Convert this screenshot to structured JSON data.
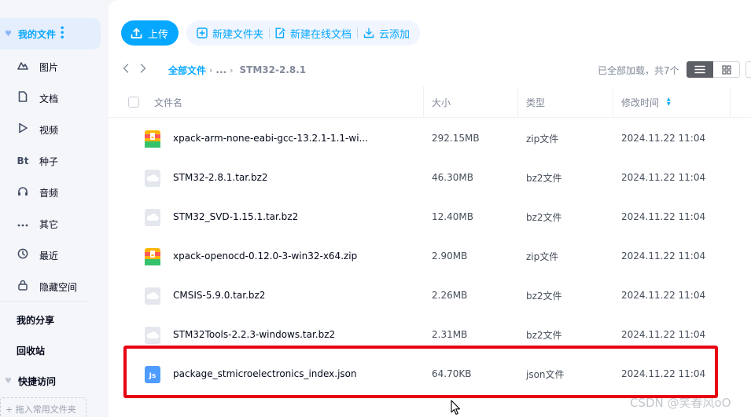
{
  "sidebar": {
    "my_files": "我的文件",
    "categories": [
      {
        "icon": "image-icon",
        "label": "图片"
      },
      {
        "icon": "document-icon",
        "label": "文档"
      },
      {
        "icon": "video-icon",
        "label": "视频"
      },
      {
        "icon": "torrent-icon",
        "glyph": "Bt",
        "label": "种子"
      },
      {
        "icon": "headphones-icon",
        "label": "音频"
      },
      {
        "icon": "more-icon",
        "label": "其它"
      },
      {
        "icon": "clock-icon",
        "label": "最近"
      },
      {
        "icon": "lock-icon",
        "label": "隐藏空间"
      }
    ],
    "my_share": "我的分享",
    "recycle_bin": "回收站",
    "quick_access": "快捷访问",
    "drop_hint": "+ 拖入常用文件夹"
  },
  "toolbar": {
    "upload": "上传",
    "new_folder": "新建文件夹",
    "new_online_doc": "新建在线文档",
    "cloud_add": "云添加"
  },
  "breadcrumb": {
    "root": "全部文件",
    "ellipsis": "...",
    "current": "STM32-2.8.1"
  },
  "status": {
    "loaded": "已全部加载，共7个"
  },
  "table": {
    "headers": {
      "name": "文件名",
      "size": "大小",
      "type": "类型",
      "modified": "修改时间"
    },
    "rows": [
      {
        "icon": "zip-icon",
        "name": "xpack-arm-none-eabi-gcc-13.2.1-1.1-wi...",
        "size": "292.15MB",
        "type": "zip文件",
        "modified": "2024.11.22 11:04"
      },
      {
        "icon": "file-icon",
        "name": "STM32-2.8.1.tar.bz2",
        "size": "46.30MB",
        "type": "bz2文件",
        "modified": "2024.11.22 11:04"
      },
      {
        "icon": "file-icon",
        "name": "STM32_SVD-1.15.1.tar.bz2",
        "size": "12.40MB",
        "type": "bz2文件",
        "modified": "2024.11.22 11:04"
      },
      {
        "icon": "zip-icon",
        "name": "xpack-openocd-0.12.0-3-win32-x64.zip",
        "size": "2.90MB",
        "type": "zip文件",
        "modified": "2024.11.22 11:04"
      },
      {
        "icon": "file-icon",
        "name": "CMSIS-5.9.0.tar.bz2",
        "size": "2.26MB",
        "type": "bz2文件",
        "modified": "2024.11.22 11:04"
      },
      {
        "icon": "file-icon",
        "name": "STM32Tools-2.2.3-windows.tar.bz2",
        "size": "2.31MB",
        "type": "bz2文件",
        "modified": "2024.11.22 11:04"
      },
      {
        "icon": "js-icon",
        "name": "package_stmicroelectronics_index.json",
        "size": "64.70KB",
        "type": "json文件",
        "modified": "2024.11.22 11:04"
      }
    ]
  },
  "watermark": "CSDN @笑春风oO",
  "colors": {
    "accent": "#06a7ff",
    "highlight": "#e60012"
  }
}
